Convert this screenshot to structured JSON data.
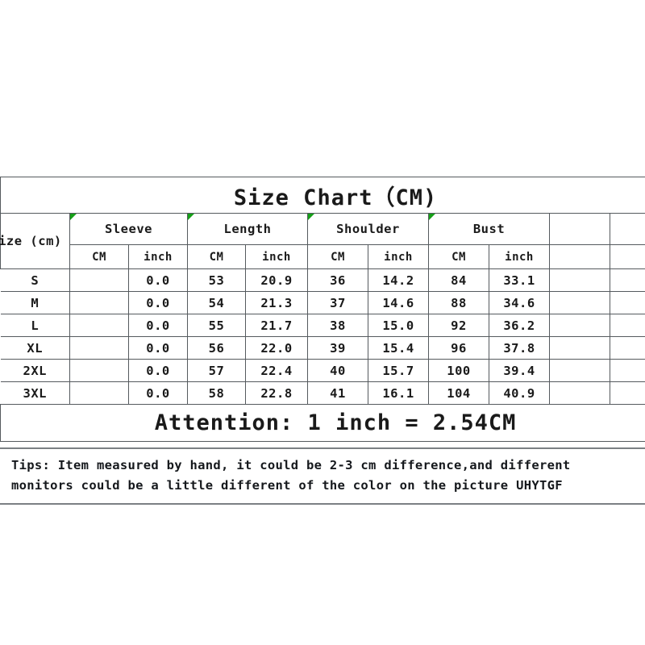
{
  "title": "Size Chart（CM)",
  "table": {
    "size_header": "Size (cm)",
    "groups": [
      "Sleeve",
      "Length",
      "Shoulder",
      "Bust"
    ],
    "unit_labels": [
      "CM",
      "inch",
      "CM",
      "inch",
      "CM",
      "inch",
      "CM",
      "inch"
    ],
    "rows": [
      {
        "size": "S",
        "sleeve_cm": "",
        "sleeve_in": "0.0",
        "length_cm": "53",
        "length_in": "20.9",
        "shoulder_cm": "36",
        "shoulder_in": "14.2",
        "bust_cm": "84",
        "bust_in": "33.1"
      },
      {
        "size": "M",
        "sleeve_cm": "",
        "sleeve_in": "0.0",
        "length_cm": "54",
        "length_in": "21.3",
        "shoulder_cm": "37",
        "shoulder_in": "14.6",
        "bust_cm": "88",
        "bust_in": "34.6"
      },
      {
        "size": "L",
        "sleeve_cm": "",
        "sleeve_in": "0.0",
        "length_cm": "55",
        "length_in": "21.7",
        "shoulder_cm": "38",
        "shoulder_in": "15.0",
        "bust_cm": "92",
        "bust_in": "36.2"
      },
      {
        "size": "XL",
        "sleeve_cm": "",
        "sleeve_in": "0.0",
        "length_cm": "56",
        "length_in": "22.0",
        "shoulder_cm": "39",
        "shoulder_in": "15.4",
        "bust_cm": "96",
        "bust_in": "37.8"
      },
      {
        "size": "2XL",
        "sleeve_cm": "",
        "sleeve_in": "0.0",
        "length_cm": "57",
        "length_in": "22.4",
        "shoulder_cm": "40",
        "shoulder_in": "15.7",
        "bust_cm": "100",
        "bust_in": "39.4"
      },
      {
        "size": "3XL",
        "sleeve_cm": "",
        "sleeve_in": "0.0",
        "length_cm": "58",
        "length_in": "22.8",
        "shoulder_cm": "41",
        "shoulder_in": "16.1",
        "bust_cm": "104",
        "bust_in": "40.9"
      }
    ]
  },
  "attention": "Attention: 1 inch = 2.54CM",
  "tips": {
    "line1": "Tips: Item measured by hand, it could be 2-3 cm difference,and different",
    "line2": "monitors could be a little different of the color on the picture UHYTGF"
  },
  "colors": {
    "unit_red": "#fb0007",
    "attention_red": "#fb0007",
    "grid_line": "#555a5e",
    "text_dark": "#1a1a1a",
    "comment_marker_green": "#16a018"
  },
  "chart_data": {
    "type": "table",
    "title": "Size Chart（CM)",
    "columns": [
      "Size (cm)",
      "Sleeve CM",
      "Sleeve inch",
      "Length CM",
      "Length inch",
      "Shoulder CM",
      "Shoulder inch",
      "Bust CM",
      "Bust inch"
    ],
    "rows": [
      [
        "S",
        "",
        "0.0",
        "53",
        "20.9",
        "36",
        "14.2",
        "84",
        "33.1"
      ],
      [
        "M",
        "",
        "0.0",
        "54",
        "21.3",
        "37",
        "14.6",
        "88",
        "34.6"
      ],
      [
        "L",
        "",
        "0.0",
        "55",
        "21.7",
        "38",
        "15.0",
        "92",
        "36.2"
      ],
      [
        "XL",
        "",
        "0.0",
        "56",
        "22.0",
        "39",
        "15.4",
        "96",
        "37.8"
      ],
      [
        "2XL",
        "",
        "0.0",
        "57",
        "22.4",
        "40",
        "15.7",
        "100",
        "39.4"
      ],
      [
        "3XL",
        "",
        "0.0",
        "58",
        "22.8",
        "41",
        "16.1",
        "104",
        "40.9"
      ]
    ],
    "notes": [
      "Attention: 1 inch = 2.54CM"
    ]
  }
}
